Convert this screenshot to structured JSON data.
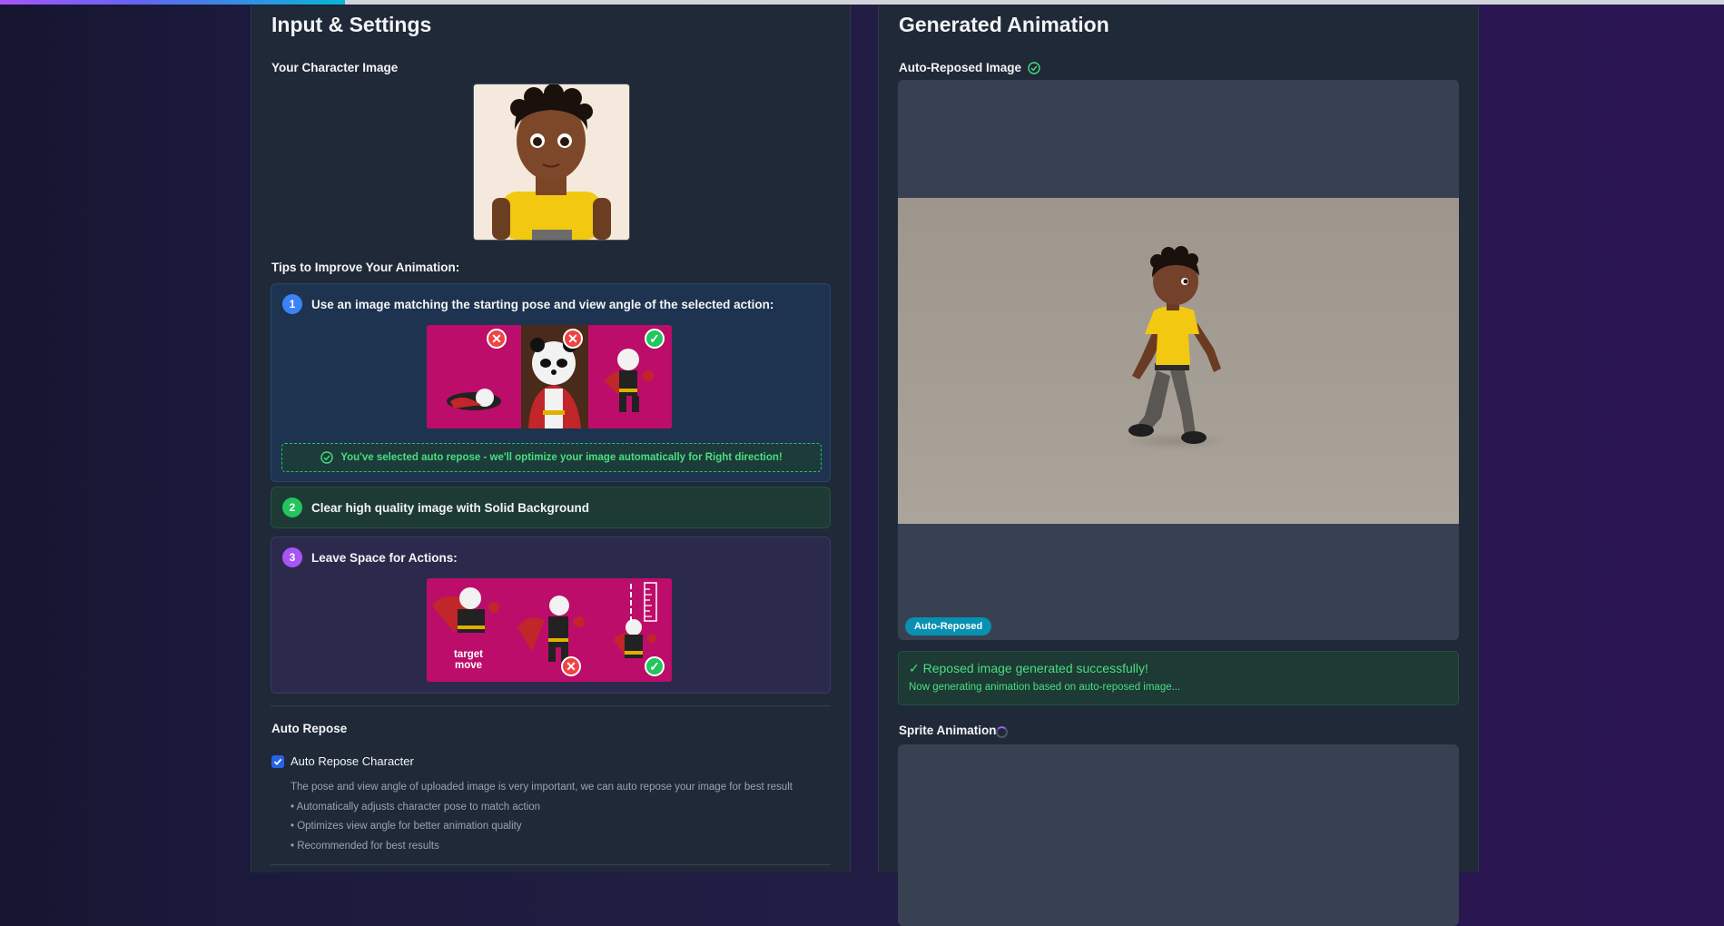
{
  "progress": {
    "fraction": 0.2
  },
  "left": {
    "title": "Input & Settings",
    "character_label": "Your Character Image",
    "tips_heading": "Tips to Improve Your Animation:",
    "tips": [
      {
        "number": "1",
        "text": "Use an image matching the starting pose and view angle of the selected action:"
      },
      {
        "number": "2",
        "text": "Clear high quality image with Solid Background"
      },
      {
        "number": "3",
        "text": "Leave Space for Actions:"
      }
    ],
    "tip3_caption": "target\nmove",
    "notice": "You've selected auto repose - we'll optimize your image automatically for Right direction!",
    "auto_repose": {
      "heading": "Auto Repose",
      "checkbox_label": "Auto Repose Character",
      "checked": true,
      "description": "The pose and view angle of uploaded image is very important, we can auto repose your image for best result",
      "bullets": [
        "• Automatically adjusts character pose to match action",
        "• Optimizes view angle for better animation quality",
        "• Recommended for best results"
      ]
    }
  },
  "right": {
    "title": "Generated Animation",
    "reposed_label": "Auto-Reposed Image",
    "badge": "Auto-Reposed",
    "success_title": "✓ Reposed image generated successfully!",
    "success_sub": "Now generating animation based on auto-reposed image...",
    "sprite_label": "Sprite Animation"
  },
  "colors": {
    "accent_blue": "#3b82f6",
    "accent_green": "#22c55e",
    "accent_purple": "#a855f7",
    "example_bg": "#bd0d6a",
    "badge_bg": "#0891b2"
  },
  "icons": [
    "check-circle-icon",
    "x-mark-icon",
    "check-mark-icon",
    "spinner-icon",
    "ruler-icon"
  ]
}
